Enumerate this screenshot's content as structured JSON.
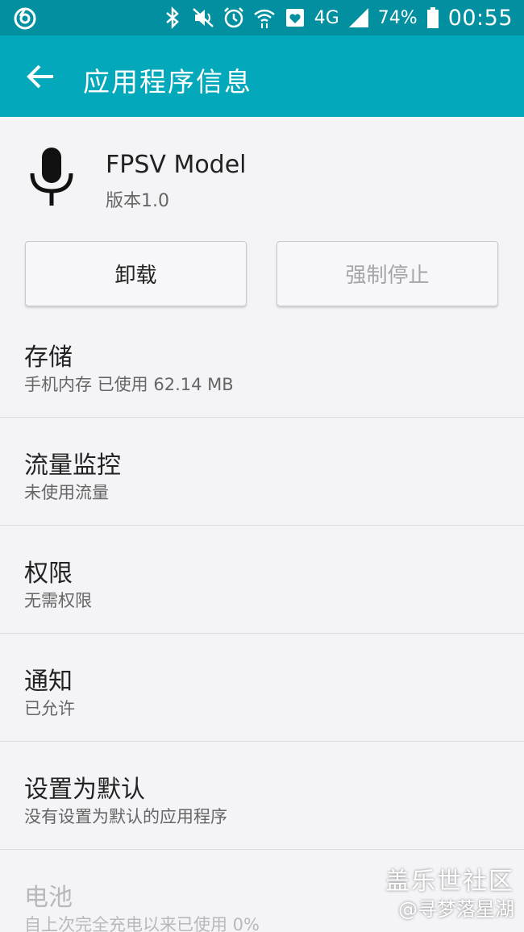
{
  "status_bar": {
    "network": "4G",
    "battery": "74%",
    "time": "00:55"
  },
  "app_bar": {
    "title": "应用程序信息"
  },
  "app": {
    "name": "FPSV Model",
    "version": "版本1.0"
  },
  "buttons": {
    "uninstall": "卸载",
    "force_stop": "强制停止"
  },
  "items": [
    {
      "title": "存储",
      "subtitle": "手机内存 已使用 62.14 MB"
    },
    {
      "title": "流量监控",
      "subtitle": "未使用流量"
    },
    {
      "title": "权限",
      "subtitle": "无需权限"
    },
    {
      "title": "通知",
      "subtitle": "已允许"
    },
    {
      "title": "设置为默认",
      "subtitle": "没有设置为默认的应用程序"
    },
    {
      "title": "电池",
      "subtitle": "自上次完全充电以来已使用 0%"
    }
  ],
  "watermark": {
    "line1": "盖乐世社区",
    "line2": "@寻梦落星湖"
  },
  "colors": {
    "status_bar": "#028fa0",
    "app_bar": "#04a8bb",
    "background": "#f4f3f6"
  }
}
